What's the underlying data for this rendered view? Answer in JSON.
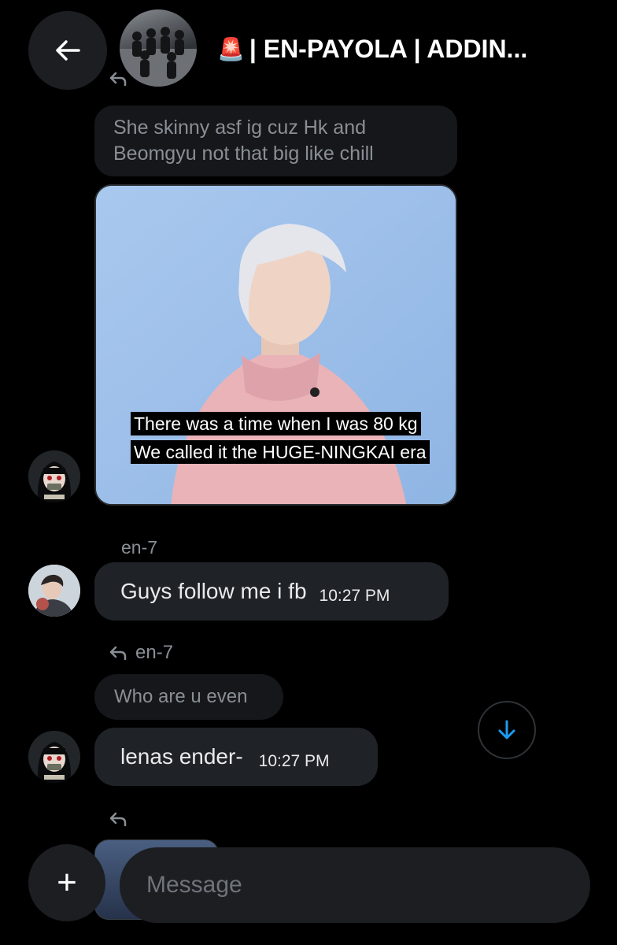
{
  "header": {
    "title": "| EN-PAYOLA | ADDIN...",
    "siren_emoji": "🚨"
  },
  "messages": {
    "quoted_1": "She skinny asf ig cuz Hk and Beomgyu not that big like chill",
    "image_caption_line1": "There was a time when I was 80 kg",
    "image_caption_line2": "We called it the HUGE-NINGKAI era",
    "sender_1": "en-7",
    "msg_1_text": "Guys follow me i fb",
    "msg_1_time": "10:27 PM",
    "reply_to_name": "en-7",
    "quoted_2": "Who are u even",
    "msg_2_text": "lenas ender-",
    "msg_2_time": "10:27 PM"
  },
  "composer": {
    "placeholder": "Message",
    "add_label": "+"
  },
  "colors": {
    "background": "#000000",
    "bubble": "#1f2226",
    "accent": "#1d9bf0"
  }
}
